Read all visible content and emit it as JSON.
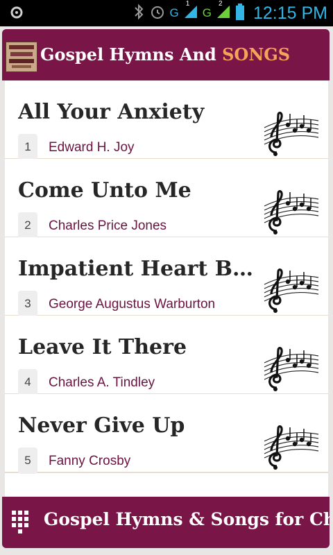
{
  "status_bar": {
    "network_label_1": "G",
    "network_label_2": "G",
    "sim_1": "1",
    "sim_2": "2",
    "time": "12:15 PM"
  },
  "header": {
    "title_main": "Gospel Hymns And",
    "title_accent": "SONGS"
  },
  "songs": [
    {
      "title": "All Your Anxiety",
      "number": "1",
      "author": "Edward H. Joy"
    },
    {
      "title": "Come Unto Me",
      "number": "2",
      "author": "Charles Price Jones"
    },
    {
      "title": "Impatient Heart Be Still",
      "number": "3",
      "author": "George Augustus Warburton"
    },
    {
      "title": "Leave It There",
      "number": "4",
      "author": "Charles A. Tindley"
    },
    {
      "title": "Never Give Up",
      "number": "5",
      "author": "Fanny Crosby"
    }
  ],
  "footer": {
    "text": "Gospel Hymns & Songs for Chu"
  },
  "colors": {
    "brand": "#7a1548",
    "accent": "#f5a35a",
    "author": "#6a1340",
    "status_icons": "#33b5e5"
  },
  "icons": {
    "item": "music-note-icon",
    "footer": "grid-menu-icon"
  }
}
